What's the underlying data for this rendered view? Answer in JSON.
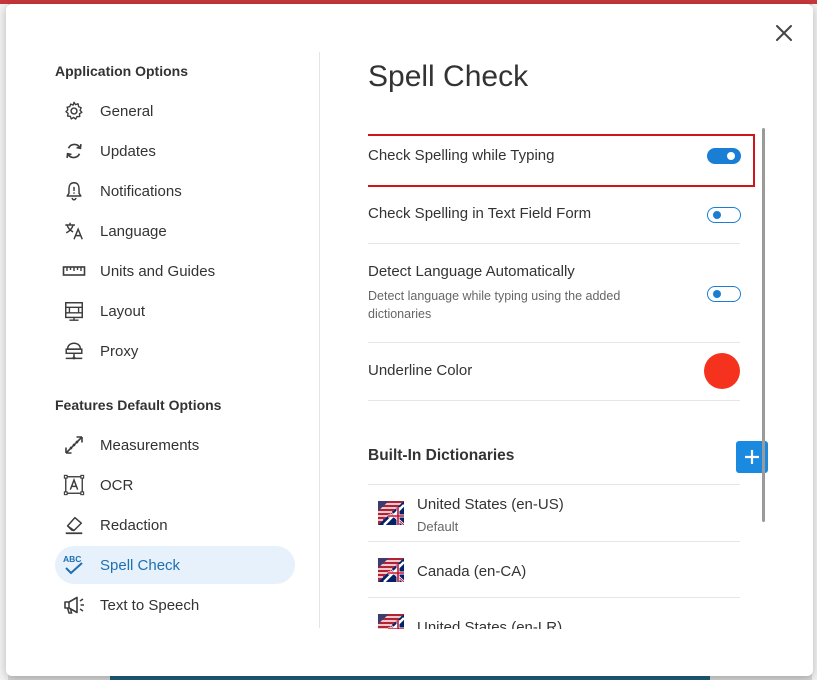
{
  "sidebar": {
    "app_section_title": "Application Options",
    "app_items": [
      {
        "label": "General",
        "icon": "gear-icon"
      },
      {
        "label": "Updates",
        "icon": "refresh-icon"
      },
      {
        "label": "Notifications",
        "icon": "bell-icon"
      },
      {
        "label": "Language",
        "icon": "translate-icon"
      },
      {
        "label": "Units and Guides",
        "icon": "ruler-icon"
      },
      {
        "label": "Layout",
        "icon": "layout-icon"
      },
      {
        "label": "Proxy",
        "icon": "network-icon"
      }
    ],
    "features_section_title": "Features Default Options",
    "feature_items": [
      {
        "label": "Measurements",
        "icon": "measure-icon"
      },
      {
        "label": "OCR",
        "icon": "ocr-icon"
      },
      {
        "label": "Redaction",
        "icon": "eraser-icon"
      },
      {
        "label": "Spell Check",
        "icon": "spellcheck-icon",
        "active": true
      },
      {
        "label": "Text to Speech",
        "icon": "megaphone-icon"
      }
    ]
  },
  "main": {
    "title": "Spell Check",
    "settings": [
      {
        "label": "Check Spelling while Typing",
        "enabled": true
      },
      {
        "label": "Check Spelling in Text Field Form",
        "enabled": false
      },
      {
        "label": "Detect Language Automatically",
        "description": "Detect language while typing using the added dictionaries",
        "enabled": false
      }
    ],
    "underline_color": {
      "label": "Underline Color",
      "color": "#f5321e"
    },
    "dictionaries": {
      "title": "Built-In Dictionaries",
      "items": [
        {
          "name": "United States (en-US)",
          "sub": "Default"
        },
        {
          "name": "Canada (en-CA)",
          "sub": ""
        },
        {
          "name": "United States (en-LR)",
          "sub": ""
        }
      ]
    }
  },
  "colors": {
    "accent": "#1a7fd4",
    "highlight_border": "#d0141c",
    "active_nav_bg": "#e6f1fb"
  }
}
